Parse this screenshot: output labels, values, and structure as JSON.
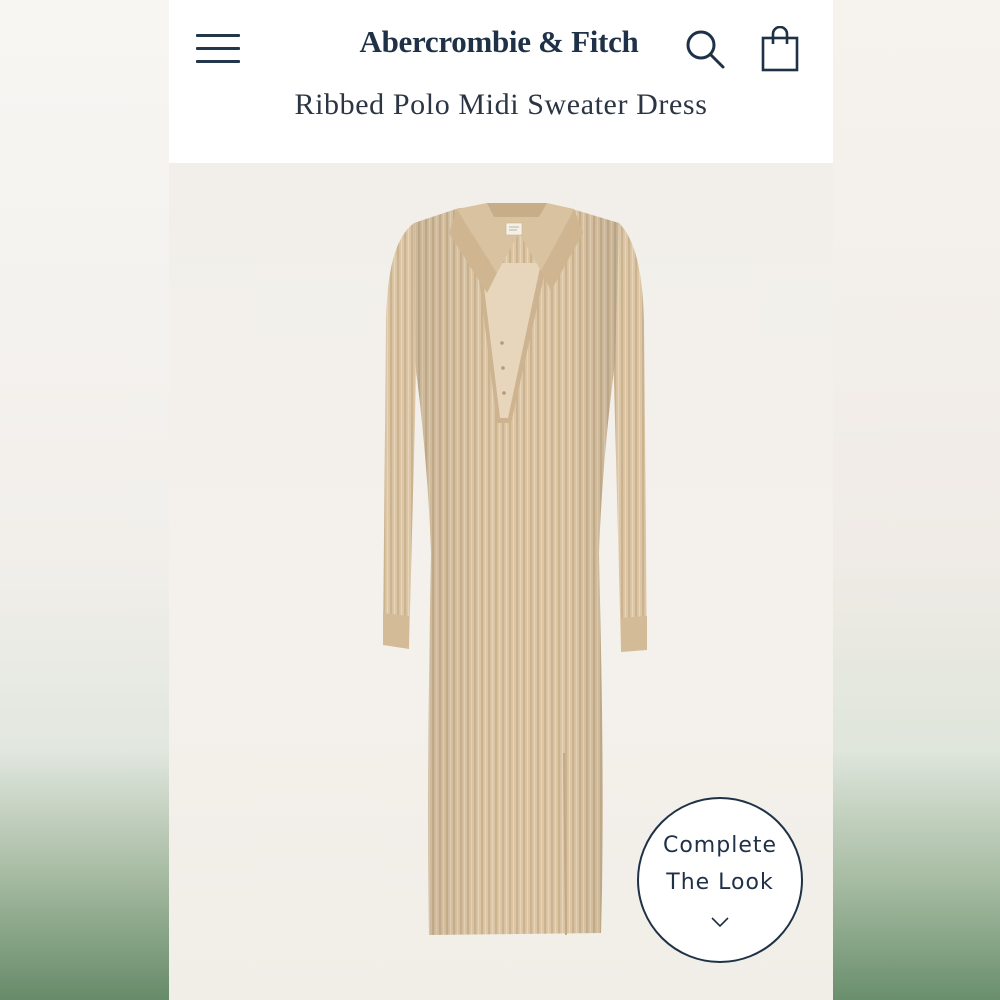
{
  "header": {
    "brand": "Abercrombie & Fitch",
    "product_title": "Ribbed Polo Midi Sweater Dress",
    "icons": {
      "menu": "hamburger-menu-icon",
      "search": "search-icon",
      "bag": "shopping-bag-icon"
    }
  },
  "product_image": {
    "subject": "beige ribbed polo midi sweater dress",
    "colors": {
      "dress": "#dcc6a6",
      "background": "#f2efea"
    }
  },
  "complete_the_look": {
    "line1": "Complete",
    "line2": "The Look",
    "icon": "chevron-down-icon"
  },
  "colors": {
    "navy": "#1f3146",
    "header_bg": "#ffffff"
  }
}
